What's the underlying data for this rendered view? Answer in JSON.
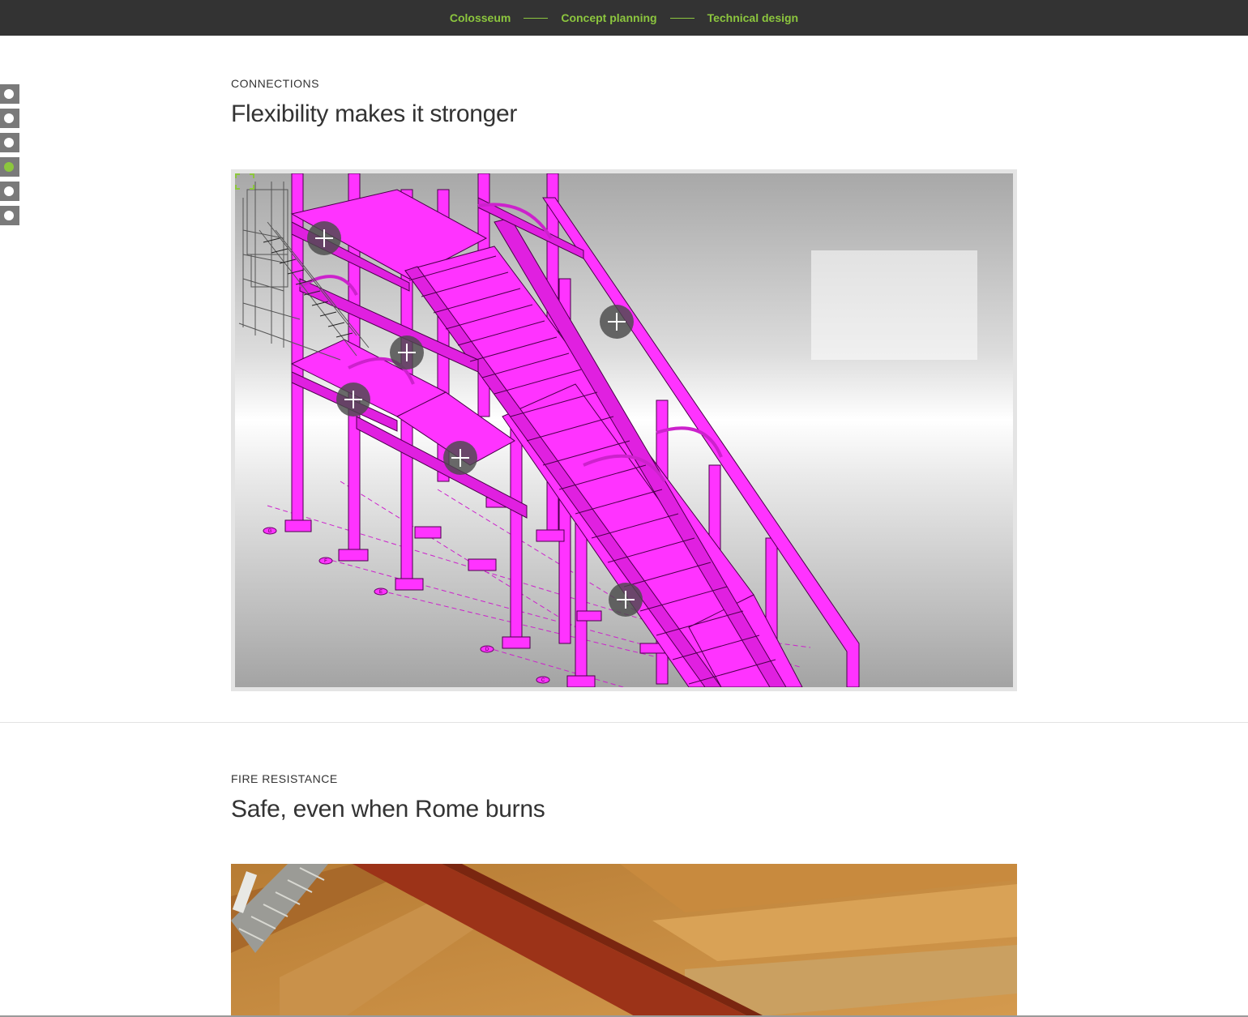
{
  "nav": {
    "breadcrumbs": [
      {
        "label": "Colosseum"
      },
      {
        "label": "Concept planning"
      },
      {
        "label": "Technical design"
      }
    ],
    "accent_color": "#8cc63e",
    "bar_color": "#333333"
  },
  "side_nav": {
    "active_index": 3,
    "dot_count": 6
  },
  "connections": {
    "label": "CONNECTIONS",
    "title": "Flexibility makes it stronger",
    "model_color": "#ff33ff",
    "hotspots": [
      "plus-icon",
      "plus-icon",
      "plus-icon",
      "plus-icon",
      "plus-icon",
      "plus-icon"
    ],
    "grid_labels": [
      "G",
      "F",
      "E",
      "D",
      "C"
    ]
  },
  "fire": {
    "label": "FIRE RESISTANCE",
    "title": "Safe, even when Rome burns"
  }
}
